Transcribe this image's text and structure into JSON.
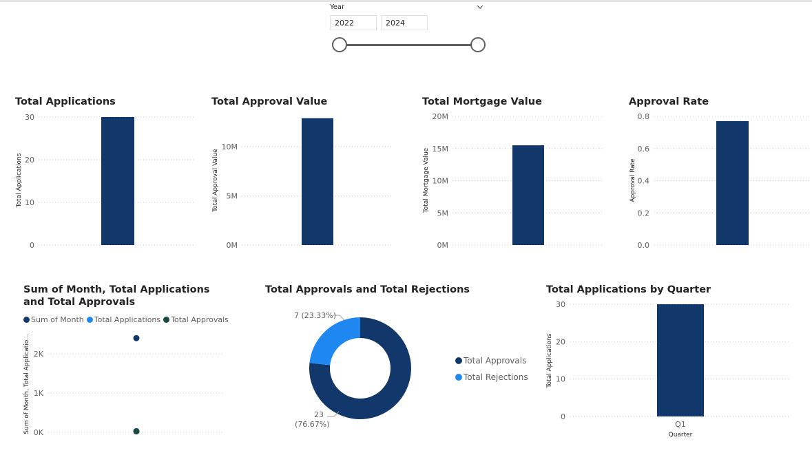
{
  "slicer": {
    "title": "Year",
    "start": "2022",
    "end": "2024",
    "range": [
      2022,
      2024
    ]
  },
  "colors": {
    "dark": "#12386b",
    "light": "#1e87f0",
    "green": "#1b4a44",
    "grid": "#c8c6c4"
  },
  "cards": [
    {
      "title": "Total Applications",
      "ylabel": "Total Applications",
      "ticks": [
        "0",
        "10",
        "20",
        "30"
      ],
      "ylim": [
        0,
        30
      ],
      "value": 30
    },
    {
      "title": "Total Approval Value",
      "ylabel": "Total Approval Value",
      "ticks": [
        "0M",
        "5M",
        "10M"
      ],
      "ylim": [
        0,
        14000000
      ],
      "value": 12900000
    },
    {
      "title": "Total Mortgage Value",
      "ylabel": "Total Mortgage Value",
      "ticks": [
        "0M",
        "5M",
        "10M",
        "15M",
        "20M"
      ],
      "ylim": [
        0,
        20000000
      ],
      "value": 15500000
    },
    {
      "title": "Approval Rate",
      "ylabel": "Approval Rate",
      "ticks": [
        "0.0",
        "0.2",
        "0.4",
        "0.6",
        "0.8"
      ],
      "ylim": [
        0,
        0.8
      ],
      "value": 0.77
    }
  ],
  "scatter": {
    "title": "Sum of Month, Total Applications and Total Approvals",
    "ylabel": "Sum of Month, Total Applicatio...",
    "ticks": [
      "0K",
      "1K",
      "2K"
    ],
    "legend": [
      "Sum of Month",
      "Total Applications",
      "Total Approvals"
    ]
  },
  "donut": {
    "title": "Total Approvals and Total Rejections",
    "legend": [
      "Total Approvals",
      "Total Rejections"
    ],
    "label_small": "7 (23.33%)",
    "label_big_1": "23",
    "label_big_2": "(76.67%)"
  },
  "quarter": {
    "title": "Total Applications by Quarter",
    "ylabel": "Total Applications",
    "xlabel": "Quarter",
    "ticks": [
      "0",
      "10",
      "20",
      "30"
    ],
    "category": "Q1"
  },
  "chart_data": [
    {
      "type": "bar",
      "title": "Total Applications",
      "categories": [
        ""
      ],
      "values": [
        30
      ],
      "ylabel": "Total Applications",
      "ylim": [
        0,
        30
      ]
    },
    {
      "type": "bar",
      "title": "Total Approval Value",
      "categories": [
        ""
      ],
      "values": [
        12900000
      ],
      "ylabel": "Total Approval Value",
      "ylim": [
        0,
        14000000
      ]
    },
    {
      "type": "bar",
      "title": "Total Mortgage Value",
      "categories": [
        ""
      ],
      "values": [
        15500000
      ],
      "ylabel": "Total Mortgage Value",
      "ylim": [
        0,
        20000000
      ]
    },
    {
      "type": "bar",
      "title": "Approval Rate",
      "categories": [
        ""
      ],
      "values": [
        0.77
      ],
      "ylabel": "Approval Rate",
      "ylim": [
        0,
        0.8
      ]
    },
    {
      "type": "scatter",
      "title": "Sum of Month, Total Applications and Total Approvals",
      "series": [
        {
          "name": "Sum of Month",
          "values": [
            2400
          ]
        },
        {
          "name": "Total Applications",
          "values": [
            30
          ]
        },
        {
          "name": "Total Approvals",
          "values": [
            23
          ]
        }
      ],
      "ylim": [
        0,
        2400
      ]
    },
    {
      "type": "pie",
      "title": "Total Approvals and Total Rejections",
      "categories": [
        "Total Approvals",
        "Total Rejections"
      ],
      "values": [
        23,
        7
      ]
    },
    {
      "type": "bar",
      "title": "Total Applications by Quarter",
      "categories": [
        "Q1"
      ],
      "values": [
        30
      ],
      "xlabel": "Quarter",
      "ylabel": "Total Applications",
      "ylim": [
        0,
        30
      ]
    }
  ]
}
